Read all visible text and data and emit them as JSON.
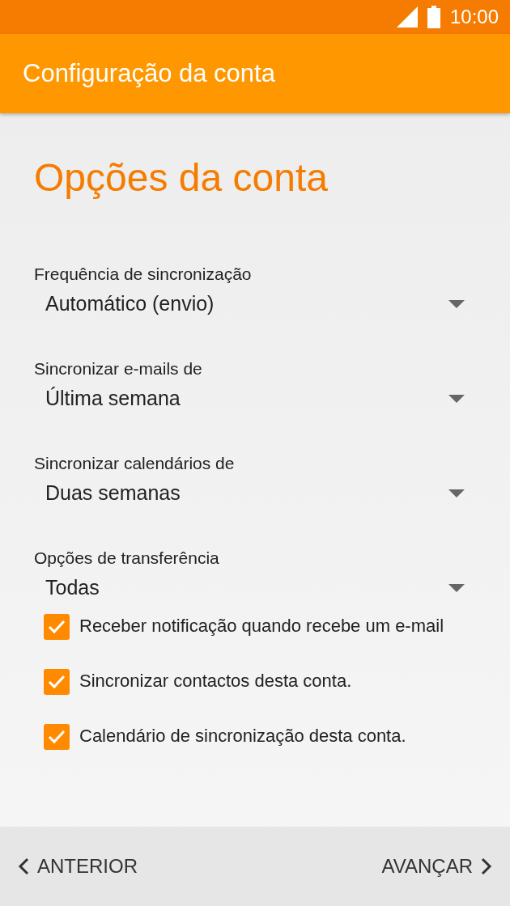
{
  "status_bar": {
    "time": "10:00"
  },
  "app_bar": {
    "title": "Configuração da conta"
  },
  "heading": "Opções da conta",
  "dropdowns": [
    {
      "label": "Frequência de sincronização",
      "value": "Automático (envio)"
    },
    {
      "label": "Sincronizar e-mails de",
      "value": "Última semana"
    },
    {
      "label": "Sincronizar calendários de",
      "value": "Duas semanas"
    },
    {
      "label": "Opções de transferência",
      "value": "Todas"
    }
  ],
  "checkboxes": [
    {
      "label": "Receber notificação quando recebe um e-mail",
      "checked": true
    },
    {
      "label": "Sincronizar contactos desta conta.",
      "checked": true
    },
    {
      "label": "Calendário de sincronização desta conta.",
      "checked": true
    }
  ],
  "nav": {
    "back": "ANTERIOR",
    "next": "AVANÇAR"
  }
}
